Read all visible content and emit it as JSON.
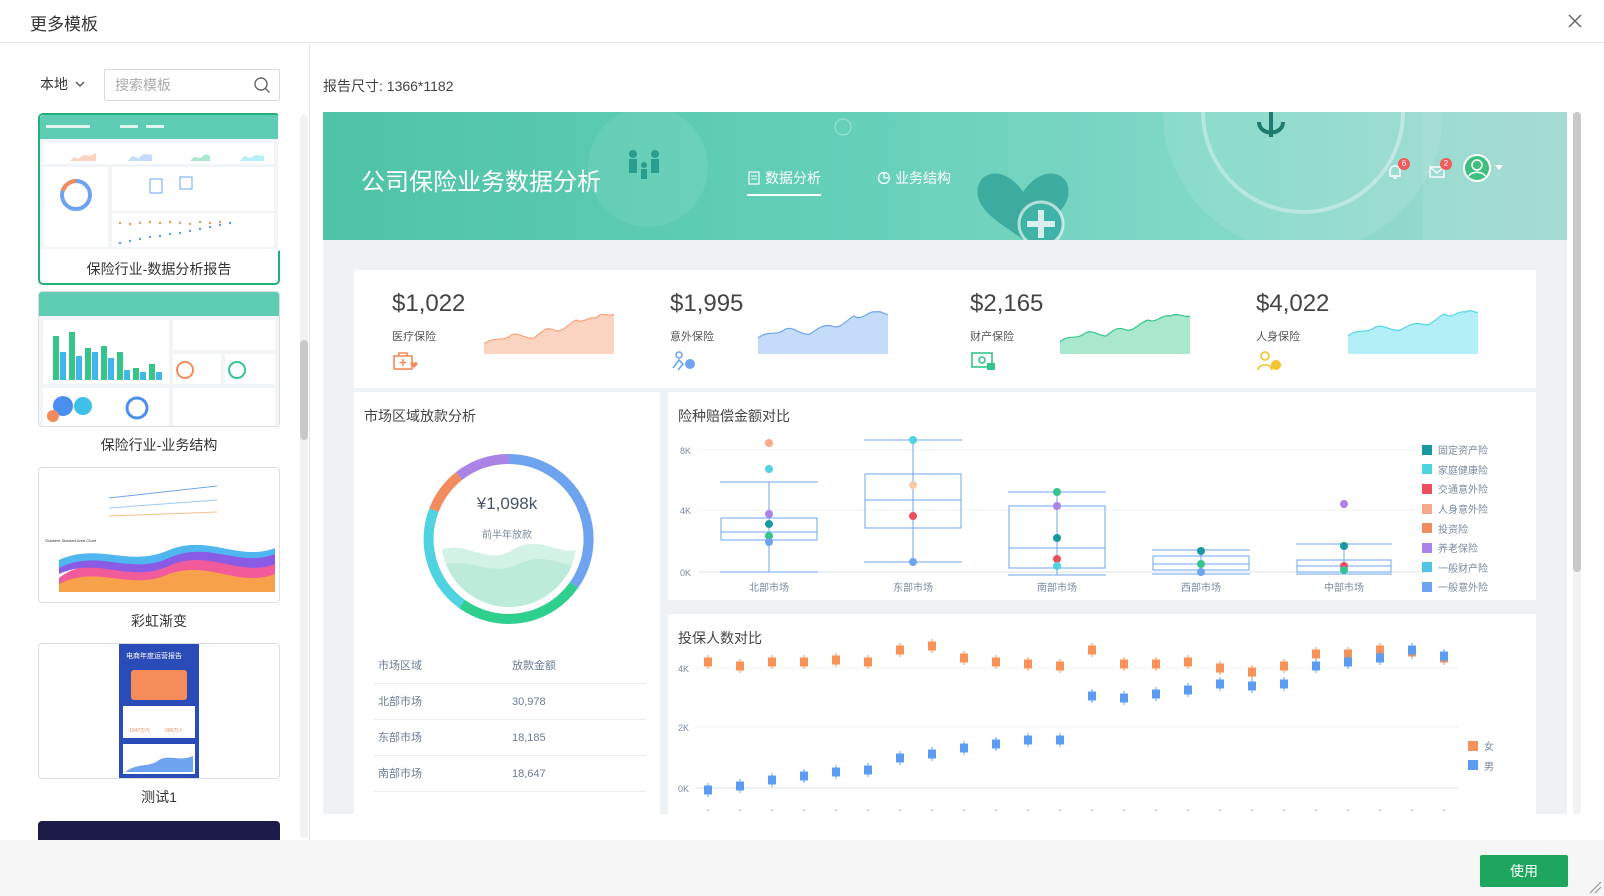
{
  "dialog": {
    "title": "更多模板",
    "use_label": "使用",
    "report_size": "报告尺寸: 1366*1182"
  },
  "sidebar": {
    "source": "本地",
    "search_placeholder": "搜索模板",
    "templates": [
      {
        "name": "保险行业-数据分析报告",
        "selected": true
      },
      {
        "name": "保险行业-业务结构",
        "selected": false
      },
      {
        "name": "彩虹渐变",
        "selected": false
      },
      {
        "name": "测试1",
        "selected": false
      }
    ],
    "thumb_texts": {
      "rainbow_subtitle": "Gradient Stacked Area Chart",
      "test_title": "电商年度运营报告",
      "test_v1": "1547万元",
      "test_v2": "996万人"
    }
  },
  "preview": {
    "header": {
      "title": "公司保险业务数据分析",
      "tabs": [
        {
          "label": "数据分析",
          "active": true
        },
        {
          "label": "业务结构",
          "active": false
        }
      ],
      "notify_count": "6",
      "mail_count": "2"
    },
    "kpis": [
      {
        "value": "$1,022",
        "label": "医疗保险",
        "color": "#f7a27b",
        "fill": "#fbd3c1"
      },
      {
        "value": "$1,995",
        "label": "意外保险",
        "color": "#6ea4ef",
        "fill": "#c4dbfa"
      },
      {
        "value": "$2,165",
        "label": "财产保险",
        "color": "#35c48a",
        "fill": "#a9e8cc"
      },
      {
        "value": "$4,022",
        "label": "人身保险",
        "color": "#52d6e6",
        "fill": "#b3eff6"
      }
    ],
    "donut": {
      "title": "市场区域放款分析",
      "value": "¥1,098k",
      "sub": "前半年放款",
      "table_headers": [
        "市场区域",
        "放款金额"
      ],
      "rows": [
        [
          "北部市场",
          "30,978"
        ],
        [
          "东部市场",
          "18,185"
        ],
        [
          "南部市场",
          "18,647"
        ]
      ]
    },
    "box": {
      "title": "险种赔偿金额对比",
      "ticks": [
        "8K",
        "4K",
        "0K"
      ],
      "markets": [
        "北部市场",
        "东部市场",
        "南部市场",
        "西部市场",
        "中部市场"
      ],
      "legend": [
        {
          "name": "固定资产险",
          "color": "#1a9aa0"
        },
        {
          "name": "家庭健康险",
          "color": "#4fd3e0"
        },
        {
          "name": "交通意外险",
          "color": "#ee4e5e"
        },
        {
          "name": "人身意外险",
          "color": "#f7a98c"
        },
        {
          "name": "投资险",
          "color": "#f38c5c"
        },
        {
          "name": "养老保险",
          "color": "#a984e6"
        },
        {
          "name": "一般财产险",
          "color": "#4fc3e8"
        },
        {
          "name": "一般意外险",
          "color": "#6ea4ef"
        }
      ]
    },
    "scatter": {
      "title": "投保人数对比",
      "ticks": [
        "4K",
        "2K",
        "0K"
      ],
      "legend": [
        {
          "name": "女",
          "color": "#f4935a"
        },
        {
          "name": "男",
          "color": "#5b9df1"
        }
      ]
    }
  }
}
